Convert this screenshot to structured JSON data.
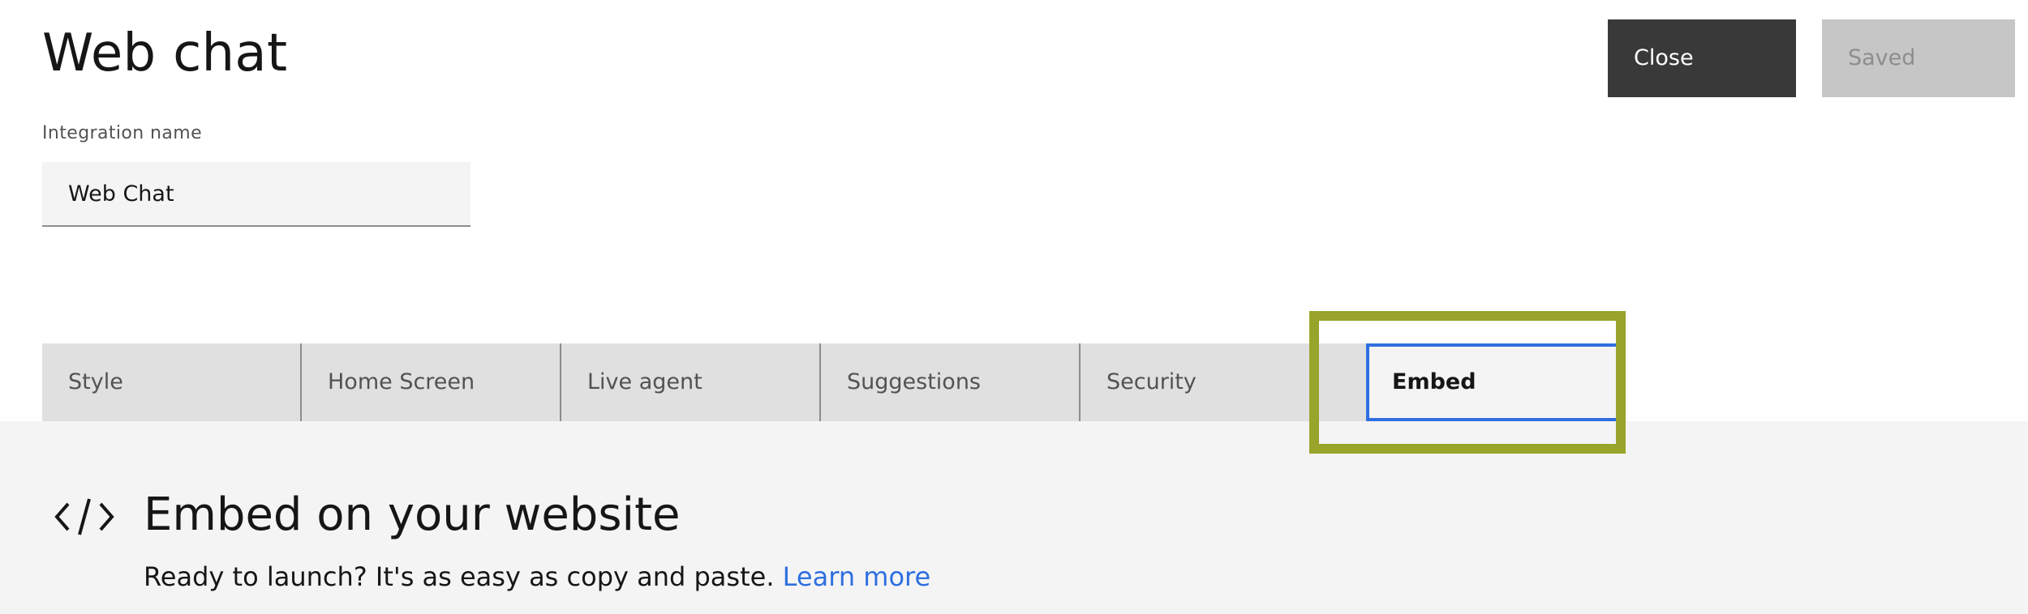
{
  "page": {
    "title": "Web chat"
  },
  "actions": {
    "close_label": "Close",
    "saved_label": "Saved"
  },
  "integration": {
    "label": "Integration name",
    "value": "Web Chat"
  },
  "tabs": [
    {
      "label": "Style"
    },
    {
      "label": "Home Screen"
    },
    {
      "label": "Live agent"
    },
    {
      "label": "Suggestions"
    },
    {
      "label": "Security"
    },
    {
      "label": "Embed",
      "selected": true
    }
  ],
  "embed": {
    "icon": "code-icon",
    "heading": "Embed on your website",
    "description": "Ready to launch? It's as easy as copy and paste.",
    "link_label": "Learn more"
  },
  "colors": {
    "accent_blue": "#2f6fe0",
    "highlight_olive": "#98a42a",
    "close_button_bg": "#393939",
    "saved_button_bg": "#c6c6c6"
  }
}
